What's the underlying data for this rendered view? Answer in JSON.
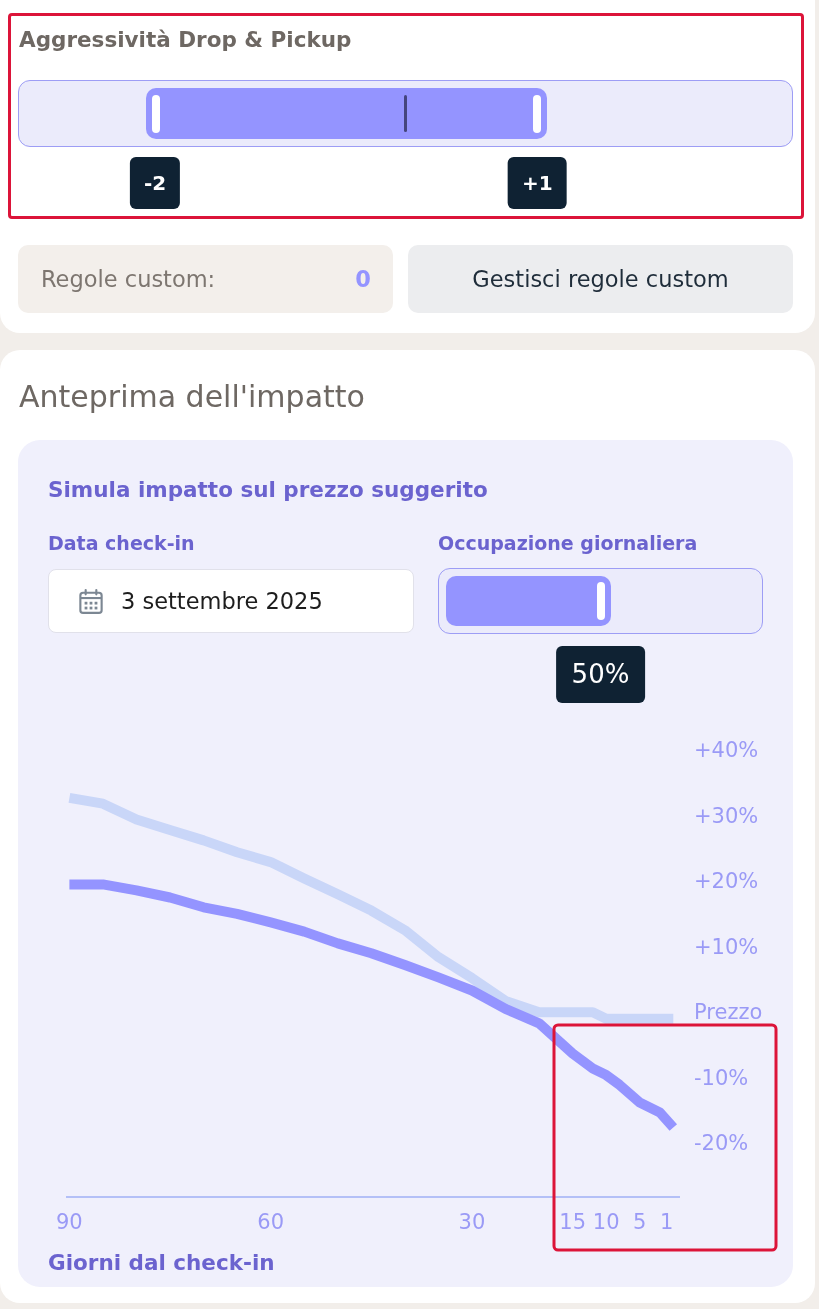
{
  "aggressiveness": {
    "title": "Aggressività Drop & Pickup",
    "highlighted": true,
    "handles": [
      {
        "label": "-2",
        "level": 0.177
      },
      {
        "label": "+1",
        "level": 0.67
      }
    ]
  },
  "custom_rules": {
    "label": "Regole custom:",
    "count": "0",
    "button": "Gestisci regole custom"
  },
  "impact_preview": {
    "title": "Anteprima dell'impatto",
    "simulation": {
      "title": "Simula impatto sul prezzo suggerito",
      "checkin_date": {
        "label": "Data check-in",
        "value": "3 settembre 2025"
      },
      "occupancy": {
        "label": "Occupazione giornaliera",
        "level": 0.5,
        "reading": "50%"
      },
      "chart_corner_highlighted": true,
      "chart_data": {
        "type": "line",
        "xlabel": "Giorni dal check-in",
        "x": [
          90,
          85,
          80,
          75,
          70,
          65,
          60,
          55,
          50,
          45,
          40,
          35,
          30,
          25,
          20,
          15,
          12,
          10,
          8,
          5,
          2,
          0
        ],
        "series": [
          {
            "color": "#c9d6f8",
            "values": [
              32.7,
              31.8,
              29.4,
              27.8,
              26.2,
              24.4,
              22.9,
              20.4,
              18.0,
              15.5,
              12.5,
              8.4,
              5.2,
              1.7,
              0,
              0,
              0,
              -1,
              -1,
              -1,
              -1,
              -1
            ]
          },
          {
            "color": "#9494ff",
            "values": [
              19.5,
              19.5,
              18.6,
              17.5,
              16.0,
              15.0,
              13.7,
              12.3,
              10.5,
              9.0,
              7.2,
              5.3,
              3.3,
              0.5,
              -1.7,
              -6.3,
              -8.6,
              -9.6,
              -11.1,
              -13.8,
              -15.3,
              -17.6
            ]
          }
        ],
        "xlim": [
          90.5,
          -1
        ],
        "ylim": [
          -28.2,
          40
        ],
        "xticks": [
          90,
          60,
          30,
          15,
          10,
          5,
          1
        ],
        "yticks": [
          {
            "value": 40,
            "label": "+40%"
          },
          {
            "value": 30,
            "label": "+30%"
          },
          {
            "value": 20,
            "label": "+20%"
          },
          {
            "value": 10,
            "label": "+10%"
          },
          {
            "value": 0,
            "label": "Prezzo"
          },
          {
            "value": -10,
            "label": "-10%"
          },
          {
            "value": -20,
            "label": "-20%"
          }
        ]
      }
    }
  }
}
